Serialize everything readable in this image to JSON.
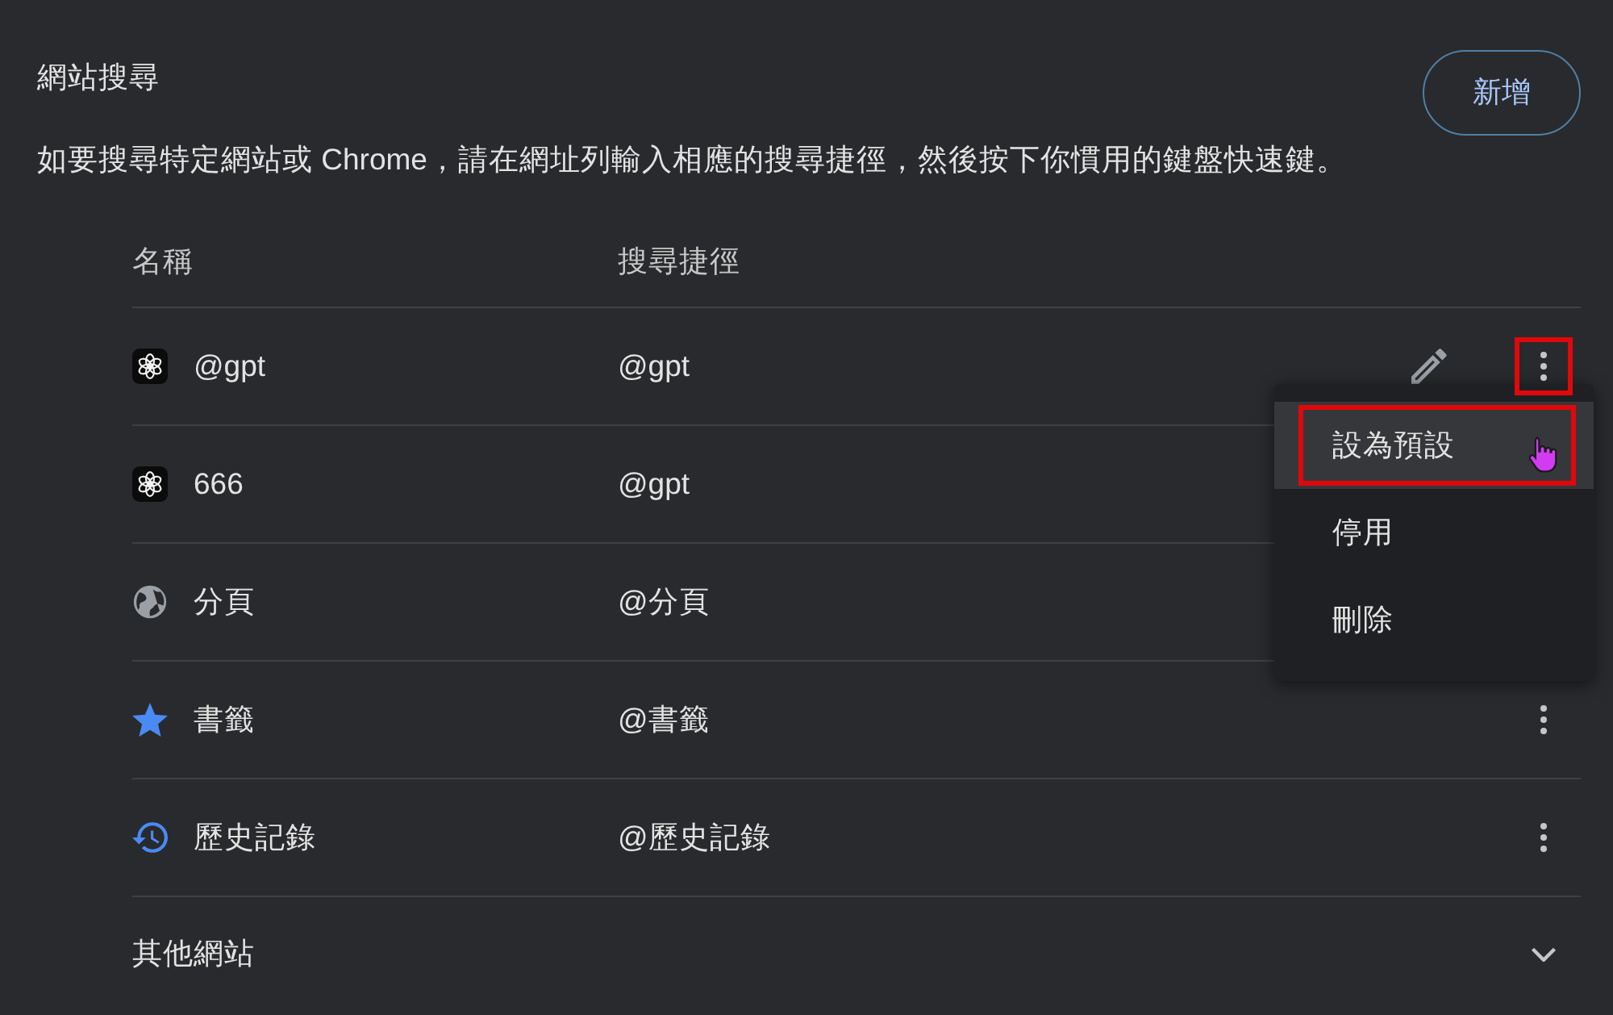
{
  "section": {
    "title": "網站搜尋",
    "description": "如要搜尋特定網站或 Chrome，請在網址列輸入相應的搜尋捷徑，然後按下你慣用的鍵盤快速鍵。",
    "add_button": "新增"
  },
  "table": {
    "columns": [
      "名稱",
      "搜尋捷徑"
    ],
    "rows": [
      {
        "kind": "knot",
        "name": "@gpt",
        "shortcut": "@gpt",
        "edit_button": true,
        "more_button": true,
        "more_marked": true
      },
      {
        "kind": "knot",
        "name": "666",
        "shortcut": "@gpt",
        "edit_button": false,
        "more_button": false
      },
      {
        "kind": "globe",
        "name": "分頁",
        "shortcut": "@分頁",
        "edit_button": false,
        "more_button": false
      },
      {
        "kind": "star",
        "name": "書籤",
        "shortcut": "@書籤",
        "edit_button": false,
        "more_button": true,
        "more_marked": false
      },
      {
        "kind": "history",
        "name": "歷史記錄",
        "shortcut": "@歷史記錄",
        "edit_button": false,
        "more_button": true,
        "more_marked": false
      }
    ]
  },
  "other_sites": {
    "label": "其他網站",
    "expanded": false
  },
  "menu": {
    "items": [
      {
        "label": "設為預設",
        "selected": true,
        "marked": true,
        "cursor": true
      },
      {
        "label": "停用",
        "selected": false,
        "marked": false,
        "cursor": false
      },
      {
        "label": "刪除",
        "selected": false,
        "marked": false,
        "cursor": false
      }
    ]
  }
}
